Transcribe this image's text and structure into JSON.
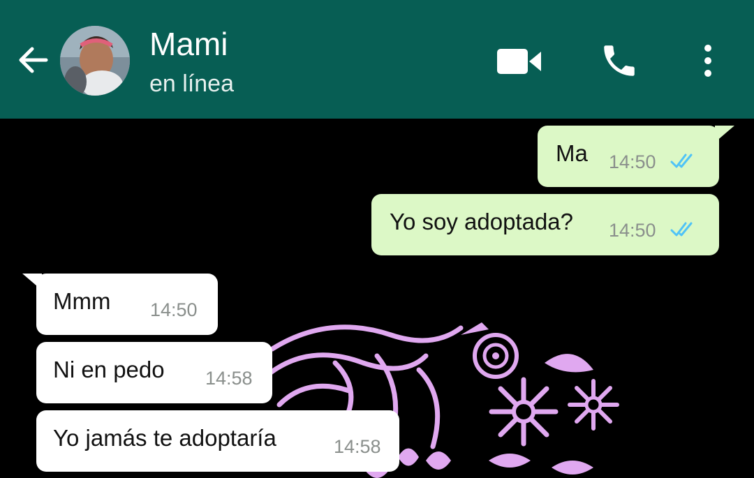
{
  "header": {
    "contact_name": "Mami",
    "status": "en línea",
    "back_icon": "arrow-left-icon",
    "avatar": "contact-avatar",
    "video_icon": "video-call-icon",
    "call_icon": "phone-icon",
    "menu_icon": "more-vert-icon",
    "color": "#075E54"
  },
  "messages": [
    {
      "direction": "outgoing",
      "text": "Ma",
      "time": "14:50",
      "status_icon": "double-check-read-icon"
    },
    {
      "direction": "outgoing",
      "text": "Yo soy adoptada?",
      "time": "14:50",
      "status_icon": "double-check-read-icon"
    },
    {
      "direction": "incoming",
      "text": "Mmm",
      "time": "14:50"
    },
    {
      "direction": "incoming",
      "text": "Ni en pedo",
      "time": "14:58"
    },
    {
      "direction": "incoming",
      "text": "Yo jamás te adoptaría",
      "time": "14:58"
    }
  ],
  "colors": {
    "outgoing_bubble": "#DCF8C6",
    "incoming_bubble": "#FFFFFF",
    "read_ticks": "#4FC3F7",
    "wallpaper": "#000000",
    "wallpaper_pattern": "#E0A8F0"
  }
}
